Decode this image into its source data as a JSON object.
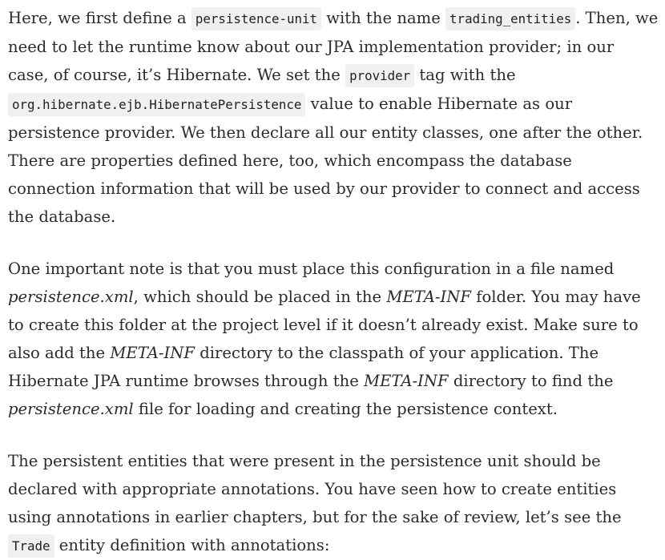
{
  "paragraph1": {
    "t1": "Here, we first define a ",
    "c1": "persistence-unit",
    "t2": " with the name ",
    "c2": "trading_entities",
    "t3": ". Then, we need to let the runtime know about our JPA implementation provider; in our case, of course, it’s Hibernate. We set the ",
    "c3": "provider",
    "t4": " tag with the ",
    "c4": "org.hibernate.ejb.HibernatePersistence",
    "t5": " value to enable Hibernate as our persistence provider. We then declare all our entity classes, one after the other. There are properties defined here, too, which encompass the database connection information that will be used by our provider to connect and access the database."
  },
  "paragraph2": {
    "t1": "One important note is that you must place this configuration in a file named ",
    "e1": "persistence.xml",
    "t2": ", which should be placed in the ",
    "e2": "META-INF",
    "t3": " folder. You may have to create this folder at the project level if it doesn’t already exist. Make sure to also add the ",
    "e3": "META-INF",
    "t4": " directory to the classpath of your application. The Hibernate JPA runtime browses through the ",
    "e4": "META-INF",
    "t5": " directory to find the ",
    "e5": "persistence.xml",
    "t6": " file for loading and creating the persistence context."
  },
  "paragraph3": {
    "t1": "The persistent entities that were present in the persistence unit should be declared with appropriate annotations. You have seen how to create entities using annotations in earlier chapters, but for the sake of review, let’s see the ",
    "c1": "Trade",
    "t2": " entity definition with annotations:"
  }
}
